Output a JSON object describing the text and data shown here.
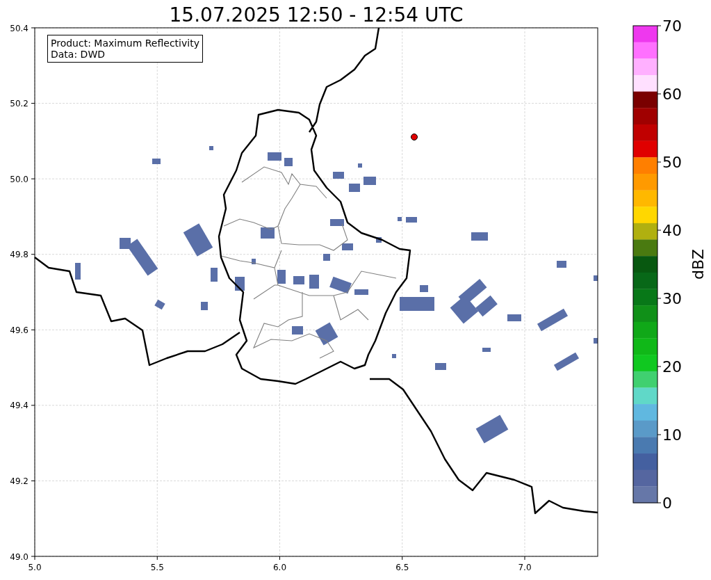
{
  "title": "15.07.2025 12:50 - 12:54 UTC",
  "annotation": [
    "Product: Maximum Reflectivity",
    "Data: DWD"
  ],
  "map": {
    "xticks": [
      "5.0",
      "5.5",
      "6.0",
      "6.5",
      "7.0"
    ],
    "yticks": [
      "50.4",
      "50.2",
      "50.0",
      "49.8",
      "49.6",
      "49.4",
      "49.2",
      "49.0"
    ]
  },
  "colorbar": {
    "label": "dBZ",
    "ticks": [
      "70",
      "60",
      "50",
      "40",
      "30",
      "20",
      "10",
      "0"
    ],
    "steps": [
      {
        "color": "#ee38ee"
      },
      {
        "color": "#ff70ff"
      },
      {
        "color": "#ffb0ff"
      },
      {
        "color": "#ffe0ff"
      },
      {
        "color": "#7a0000"
      },
      {
        "color": "#a00000"
      },
      {
        "color": "#c00000"
      },
      {
        "color": "#e00000"
      },
      {
        "color": "#ff7f00"
      },
      {
        "color": "#ff9a00"
      },
      {
        "color": "#ffb800"
      },
      {
        "color": "#ffd700"
      },
      {
        "color": "#b0b010"
      },
      {
        "color": "#4a7a10"
      },
      {
        "color": "#085810"
      },
      {
        "color": "#086818"
      },
      {
        "color": "#087818"
      },
      {
        "color": "#109018"
      },
      {
        "color": "#10a818"
      },
      {
        "color": "#10b818"
      },
      {
        "color": "#10c820"
      },
      {
        "color": "#40d070"
      },
      {
        "color": "#60d8c8"
      },
      {
        "color": "#60b8e0"
      },
      {
        "color": "#5a9ac8"
      },
      {
        "color": "#4a7ab0"
      },
      {
        "color": "#4460a0"
      },
      {
        "color": "#5566a0"
      },
      {
        "color": "#6677a8"
      }
    ]
  }
}
